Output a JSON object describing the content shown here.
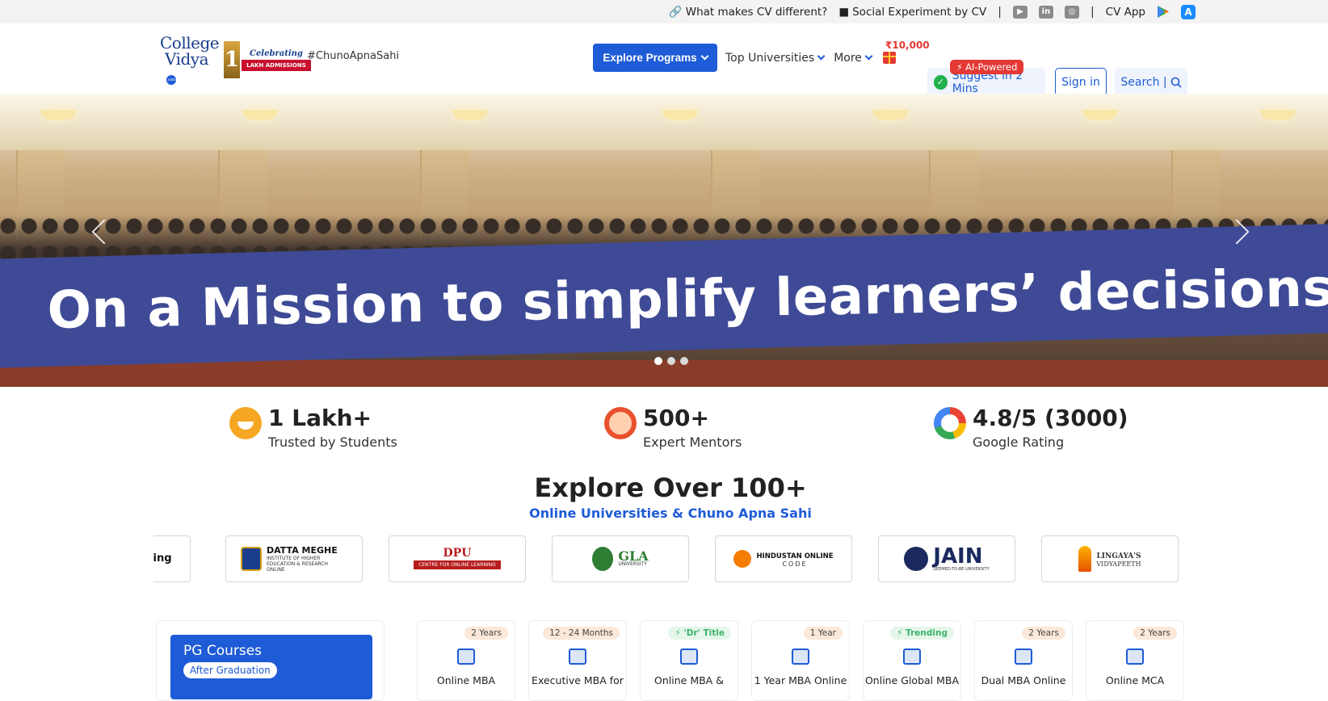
{
  "topbar": {
    "link_different": "What makes CV different?",
    "link_social": "Social Experiment by CV",
    "sep": "|",
    "social_icons": [
      "youtube-icon",
      "linkedin-icon",
      "instagram-icon"
    ],
    "cv_app": "CV App",
    "app_icons": [
      "google-play-icon",
      "app-store-icon"
    ]
  },
  "logo": {
    "line1": "College",
    "line2": "Vidya",
    "badge": ".com",
    "celebrating": "Celebrating",
    "ribbon": "LAKH ADMISSIONS",
    "big_digit": "1"
  },
  "header": {
    "hashtag": "#ChunoApnaSahi",
    "explore_programs": "Explore Programs",
    "top_universities": "Top Universities",
    "more": "More",
    "gift_amount": "₹10,000",
    "ai_pill": "AI-Powered",
    "suggest": "Suggest in 2 Mins",
    "sign_in": "Sign in",
    "search": "Search |"
  },
  "hero": {
    "banner_text": "On a Mission to simplify learners’ decisions",
    "slides": 3,
    "active_slide": 1
  },
  "stats": [
    {
      "value": "1 Lakh+",
      "label": "Trusted by Students",
      "icon": "smile-icon"
    },
    {
      "value": "500+",
      "label": "Expert Mentors",
      "icon": "mentor-icon"
    },
    {
      "value": "4.8/5 (3000)",
      "label": "Google Rating",
      "icon": "google-icon"
    }
  ],
  "explore": {
    "title": "Explore Over 100+",
    "subtitle": "Online Universities & Chuno Apna Sahi"
  },
  "universities": [
    {
      "name": "ing",
      "sub": "",
      "color": "#d32f2f"
    },
    {
      "name": "DATTA MEGHE",
      "sub": "INSTITUTE OF HIGHER EDUCATION & RESEARCH ONLINE",
      "color": "#1a3e8c"
    },
    {
      "name": "DPU",
      "sub": "CENTRE FOR ONLINE LEARNING",
      "color": "#b71c1c"
    },
    {
      "name": "GLA",
      "sub": "UNIVERSITY",
      "color": "#2e7d32"
    },
    {
      "name": "HINDUSTAN ONLINE",
      "sub": "CODE",
      "color": "#f57c00"
    },
    {
      "name": "JAIN",
      "sub": "DEEMED-TO-BE UNIVERSITY",
      "color": "#1a2a5e"
    },
    {
      "name": "LINGAYA'S",
      "sub": "VIDYAPEETH",
      "color": "#e65100"
    }
  ],
  "pg_card": {
    "title": "PG Courses",
    "pill": "After Graduation"
  },
  "courses": [
    {
      "name": "Online MBA",
      "badge": "2 Years",
      "badge_type": "normal"
    },
    {
      "name": "Executive MBA for",
      "badge": "12 - 24 Months",
      "badge_type": "normal"
    },
    {
      "name": "Online MBA &",
      "badge": "'Dr' Title",
      "badge_type": "green"
    },
    {
      "name": "1 Year MBA Online",
      "badge": "1 Year",
      "badge_type": "normal"
    },
    {
      "name": "Online Global MBA",
      "badge": "Trending",
      "badge_type": "green"
    },
    {
      "name": "Dual MBA Online",
      "badge": "2 Years",
      "badge_type": "normal"
    },
    {
      "name": "Online MCA",
      "badge": "2 Years",
      "badge_type": "normal"
    }
  ],
  "colors": {
    "primary": "#1e5bd6",
    "accent_red": "#e53935",
    "banner_blue": "#3f4a96"
  }
}
